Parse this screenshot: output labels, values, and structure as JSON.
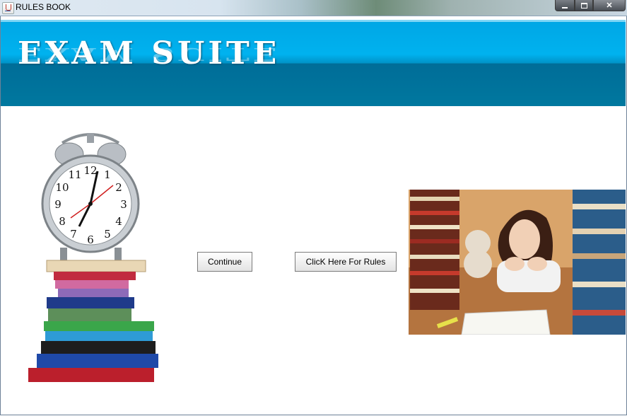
{
  "window": {
    "title": "RULES BOOK"
  },
  "banner": {
    "title": "EXAM SUITE"
  },
  "buttons": {
    "continue": "Continue",
    "rules": "ClicK Here For Rules"
  },
  "icons": [
    "app-java-icon",
    "minimize-icon",
    "maximize-icon",
    "close-icon"
  ],
  "images": [
    "alarm-clock-on-books-image",
    "student-with-books-image"
  ]
}
